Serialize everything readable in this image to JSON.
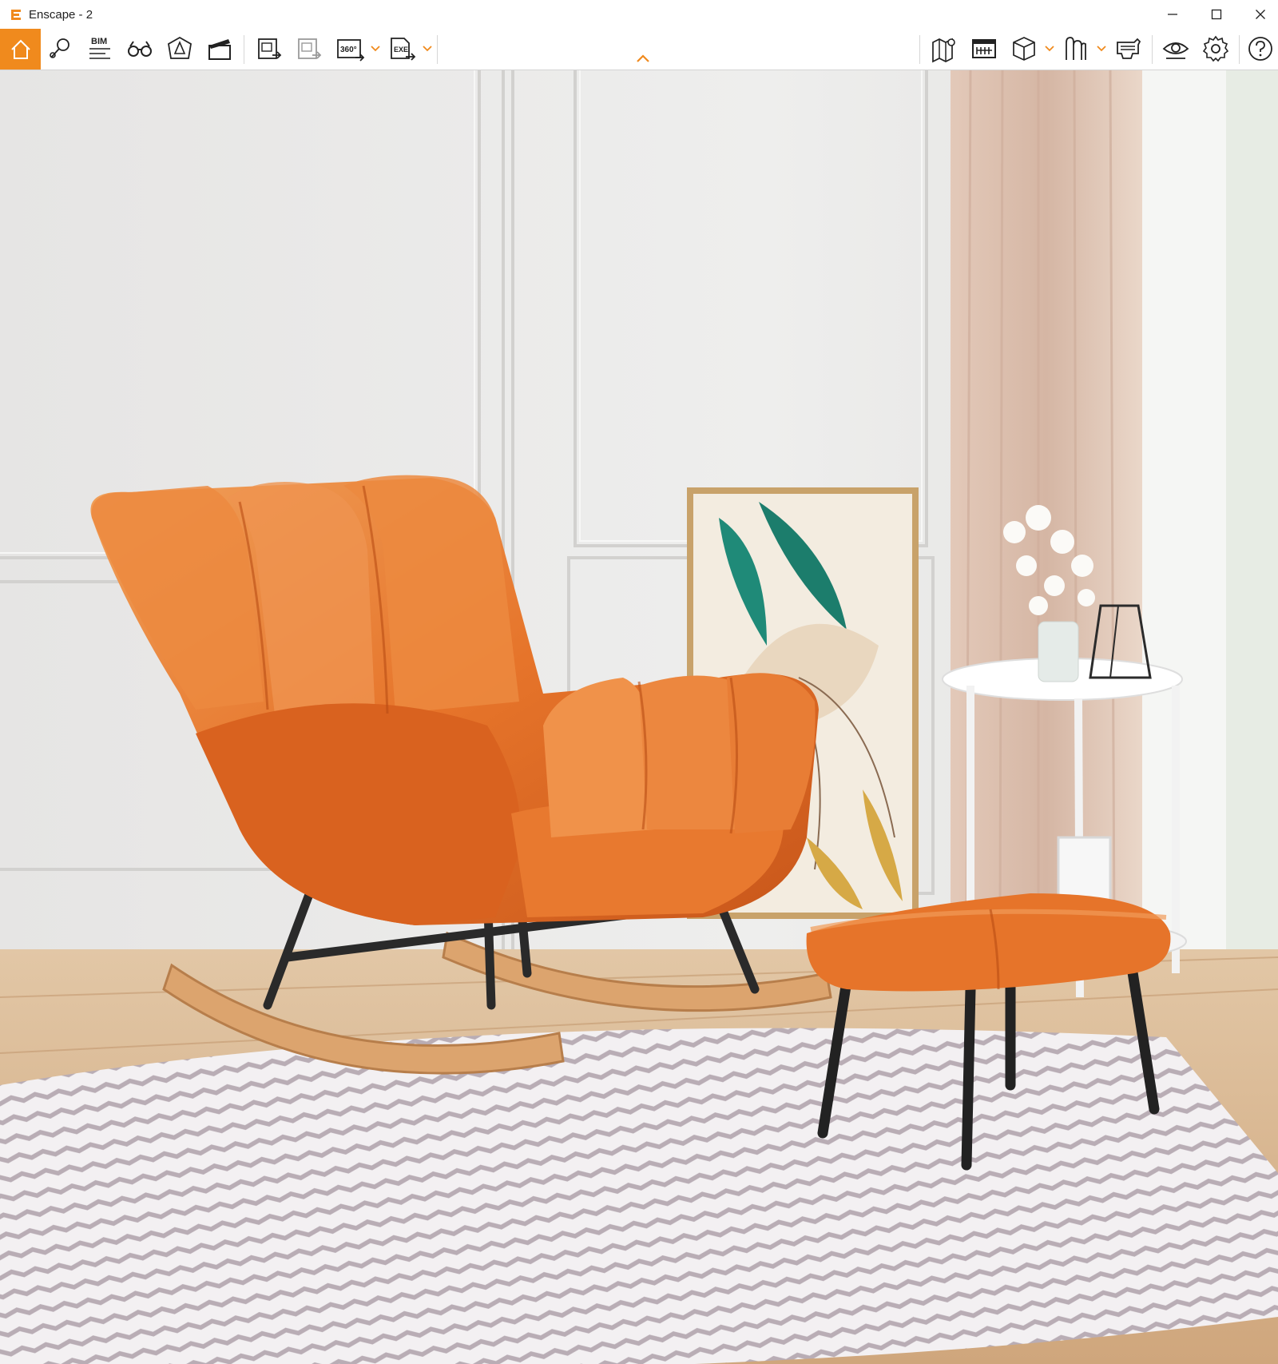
{
  "window": {
    "title": "Enscape - 2",
    "accent_color": "#f08a1d",
    "controls": [
      {
        "name": "minimize-button",
        "icon": "minimize-icon"
      },
      {
        "name": "maximize-button",
        "icon": "maximize-icon"
      },
      {
        "name": "close-button",
        "icon": "close-icon"
      }
    ]
  },
  "toolbar": {
    "left_tools": [
      {
        "name": "home",
        "icon": "home-icon",
        "active": true
      },
      {
        "name": "views",
        "icon": "map-pin-icon"
      },
      {
        "name": "bim",
        "icon": "bim-icon",
        "label": "BIM"
      },
      {
        "name": "binoculars",
        "icon": "binoculars-icon"
      },
      {
        "name": "asset-library",
        "icon": "asset-icon"
      },
      {
        "name": "video-editor",
        "icon": "clapperboard-icon"
      },
      {
        "name": "screenshot",
        "icon": "image-export-icon"
      },
      {
        "name": "batch-render",
        "icon": "batch-export-icon"
      },
      {
        "name": "panorama",
        "icon": "panorama-360-icon",
        "label": "360°",
        "has_dropdown": true
      },
      {
        "name": "exe-export",
        "icon": "exe-export-icon",
        "label": "EXE",
        "has_dropdown": true
      }
    ],
    "right_tools": [
      {
        "name": "map",
        "icon": "map-icon"
      },
      {
        "name": "material-editor",
        "icon": "material-icon"
      },
      {
        "name": "box-view",
        "icon": "cube-icon",
        "has_dropdown": true
      },
      {
        "name": "collaborative-annotation",
        "icon": "annotation-icon",
        "has_dropdown": true
      },
      {
        "name": "vr-headset",
        "icon": "vr-icon"
      },
      {
        "name": "visual-settings",
        "icon": "eye-icon"
      },
      {
        "name": "general-settings",
        "icon": "gear-icon"
      },
      {
        "name": "help",
        "icon": "help-icon"
      }
    ],
    "collapse_icon": "chevron-up-icon"
  },
  "viewport": {
    "scene": "rendered-interior",
    "colors": {
      "wall": "#ebeae8",
      "chair": "#e6742a",
      "rug_stripe_a": "#f4f1f3",
      "rug_stripe_b": "#b8acb4",
      "floor": "#d6b48f",
      "curtain": "#dcc0b0",
      "wood": "#dca46e",
      "metal": "#2a2a2a"
    }
  }
}
